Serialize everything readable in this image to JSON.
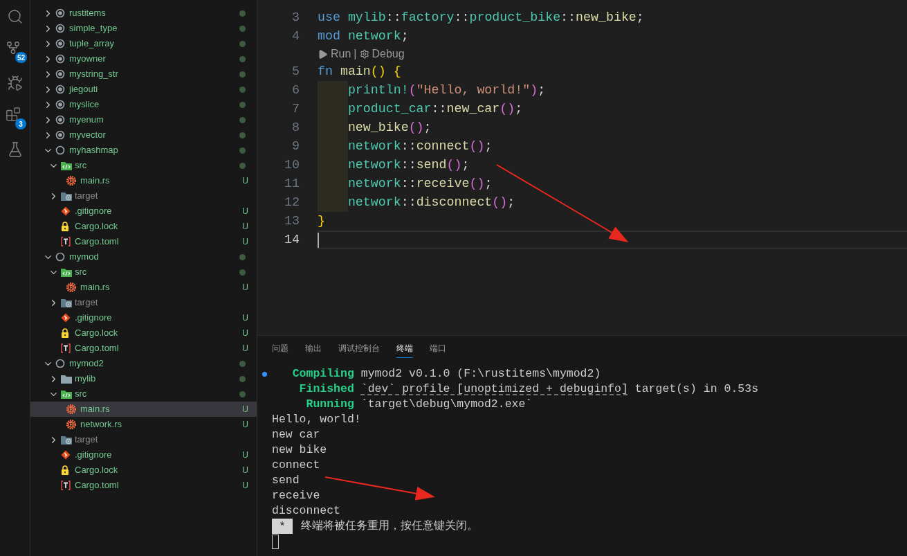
{
  "activity_bar": [
    {
      "kind": "search"
    },
    {
      "kind": "source-control",
      "badge": "52"
    },
    {
      "kind": "run-debug"
    },
    {
      "kind": "extensions",
      "badge": "3"
    },
    {
      "kind": "testing"
    }
  ],
  "explorer": {
    "items": [
      {
        "name": "rustitems",
        "kind": "project",
        "expanded": false,
        "modified": true,
        "selected": false
      },
      {
        "name": "simple_type",
        "kind": "project",
        "expanded": false,
        "modified": true,
        "selected": false
      },
      {
        "name": "tuple_array",
        "kind": "project",
        "expanded": false,
        "modified": true,
        "selected": false
      },
      {
        "name": "myowner",
        "kind": "project",
        "expanded": false,
        "modified": true,
        "selected": false
      },
      {
        "name": "mystring_str",
        "kind": "project",
        "expanded": false,
        "modified": true,
        "selected": false
      },
      {
        "name": "jiegouti",
        "kind": "project",
        "expanded": false,
        "modified": true,
        "selected": false
      },
      {
        "name": "myslice",
        "kind": "project",
        "expanded": false,
        "modified": true,
        "selected": false
      },
      {
        "name": "myenum",
        "kind": "project",
        "expanded": false,
        "modified": true,
        "selected": false
      },
      {
        "name": "myvector",
        "kind": "project",
        "expanded": false,
        "modified": true,
        "selected": false
      },
      {
        "name": "myhashmap",
        "kind": "project",
        "expanded": true,
        "modified": true,
        "selected": false,
        "children": [
          {
            "name": "src",
            "kind": "src-folder",
            "expanded": true,
            "modified": true,
            "selected": false,
            "children": [
              {
                "name": "main.rs",
                "kind": "rust",
                "status": "U",
                "modified": false,
                "selected": false
              }
            ]
          },
          {
            "name": "target",
            "kind": "target-folder",
            "expanded": false,
            "ignored": true,
            "modified": false,
            "selected": false
          },
          {
            "name": ".gitignore",
            "kind": "git",
            "status": "U",
            "modified": false,
            "selected": false
          },
          {
            "name": "Cargo.lock",
            "kind": "lock",
            "status": "U",
            "modified": false,
            "selected": false
          },
          {
            "name": "Cargo.toml",
            "kind": "toml",
            "status": "U",
            "modified": false,
            "selected": false
          }
        ]
      },
      {
        "name": "mymod",
        "kind": "project",
        "expanded": true,
        "modified": true,
        "selected": false,
        "children": [
          {
            "name": "src",
            "kind": "src-folder",
            "expanded": true,
            "modified": true,
            "selected": false,
            "children": [
              {
                "name": "main.rs",
                "kind": "rust",
                "status": "U",
                "modified": false,
                "selected": false
              }
            ]
          },
          {
            "name": "target",
            "kind": "target-folder",
            "expanded": false,
            "ignored": true,
            "modified": false,
            "selected": false
          },
          {
            "name": ".gitignore",
            "kind": "git",
            "status": "U",
            "modified": false,
            "selected": false
          },
          {
            "name": "Cargo.lock",
            "kind": "lock",
            "status": "U",
            "modified": false,
            "selected": false
          },
          {
            "name": "Cargo.toml",
            "kind": "toml",
            "status": "U",
            "modified": false,
            "selected": false
          }
        ]
      },
      {
        "name": "mymod2",
        "kind": "project",
        "expanded": true,
        "modified": true,
        "selected": false,
        "children": [
          {
            "name": "mylib",
            "kind": "folder",
            "expanded": false,
            "modified": true,
            "selected": false
          },
          {
            "name": "src",
            "kind": "src-folder",
            "expanded": true,
            "modified": true,
            "selected": false,
            "children": [
              {
                "name": "main.rs",
                "kind": "rust",
                "status": "U",
                "modified": false,
                "selected": true
              },
              {
                "name": "network.rs",
                "kind": "rust",
                "status": "U",
                "modified": false,
                "selected": false
              }
            ]
          },
          {
            "name": "target",
            "kind": "target-folder",
            "expanded": false,
            "ignored": true,
            "modified": false,
            "selected": false
          },
          {
            "name": ".gitignore",
            "kind": "git",
            "status": "U",
            "modified": false,
            "selected": false
          },
          {
            "name": "Cargo.lock",
            "kind": "lock",
            "status": "U",
            "modified": false,
            "selected": false
          },
          {
            "name": "Cargo.toml",
            "kind": "toml",
            "status": "U",
            "modified": false,
            "selected": false
          }
        ]
      }
    ]
  },
  "editor": {
    "lines": [
      {
        "kind": "code",
        "number": "3",
        "selected": false,
        "tokens": [
          {
            "kind": "keyword",
            "text": "use "
          },
          {
            "kind": "module",
            "text": "mylib"
          },
          {
            "kind": "punct",
            "text": "::"
          },
          {
            "kind": "module",
            "text": "factory"
          },
          {
            "kind": "punct",
            "text": "::"
          },
          {
            "kind": "module",
            "text": "product_bike"
          },
          {
            "kind": "punct",
            "text": "::"
          },
          {
            "kind": "function",
            "text": "new_bike"
          },
          {
            "kind": "punct",
            "text": ";"
          }
        ]
      },
      {
        "kind": "code",
        "number": "4",
        "selected": false,
        "tokens": [
          {
            "kind": "keyword",
            "text": "mod "
          },
          {
            "kind": "module",
            "text": "network"
          },
          {
            "kind": "punct",
            "text": ";"
          }
        ]
      },
      {
        "kind": "codelens",
        "run": "Run",
        "separator": "|",
        "debug": "Debug"
      },
      {
        "kind": "code",
        "number": "5",
        "selected": false,
        "tokens": [
          {
            "kind": "keyword",
            "text": "fn "
          },
          {
            "kind": "function",
            "text": "main"
          },
          {
            "kind": "bracket",
            "text": "() {"
          }
        ]
      },
      {
        "kind": "code",
        "number": "6",
        "selected": false,
        "indented": true,
        "tokens": [
          {
            "kind": "module",
            "text": "println!"
          },
          {
            "kind": "bracket2",
            "text": "("
          },
          {
            "kind": "string",
            "text": "\"Hello, world!\""
          },
          {
            "kind": "bracket2",
            "text": ")"
          },
          {
            "kind": "punct",
            "text": ";"
          }
        ]
      },
      {
        "kind": "code",
        "number": "7",
        "selected": false,
        "indented": true,
        "tokens": [
          {
            "kind": "module",
            "text": "product_car"
          },
          {
            "kind": "punct",
            "text": "::"
          },
          {
            "kind": "function",
            "text": "new_car"
          },
          {
            "kind": "bracket2",
            "text": "()"
          },
          {
            "kind": "punct",
            "text": ";"
          }
        ]
      },
      {
        "kind": "code",
        "number": "8",
        "selected": false,
        "indented": true,
        "tokens": [
          {
            "kind": "function",
            "text": "new_bike"
          },
          {
            "kind": "bracket2",
            "text": "()"
          },
          {
            "kind": "punct",
            "text": ";"
          }
        ]
      },
      {
        "kind": "code",
        "number": "9",
        "selected": false,
        "indented": true,
        "tokens": [
          {
            "kind": "module",
            "text": "network"
          },
          {
            "kind": "punct",
            "text": "::"
          },
          {
            "kind": "function",
            "text": "connect"
          },
          {
            "kind": "bracket2",
            "text": "()"
          },
          {
            "kind": "punct",
            "text": ";"
          }
        ]
      },
      {
        "kind": "code",
        "number": "10",
        "selected": false,
        "indented": true,
        "tokens": [
          {
            "kind": "module",
            "text": "network"
          },
          {
            "kind": "punct",
            "text": "::"
          },
          {
            "kind": "function",
            "text": "send"
          },
          {
            "kind": "bracket2",
            "text": "()"
          },
          {
            "kind": "punct",
            "text": ";"
          }
        ]
      },
      {
        "kind": "code",
        "number": "11",
        "selected": false,
        "indented": true,
        "tokens": [
          {
            "kind": "module",
            "text": "network"
          },
          {
            "kind": "punct",
            "text": "::"
          },
          {
            "kind": "function",
            "text": "receive"
          },
          {
            "kind": "bracket2",
            "text": "()"
          },
          {
            "kind": "punct",
            "text": ";"
          }
        ]
      },
      {
        "kind": "code",
        "number": "12",
        "selected": false,
        "indented": true,
        "tokens": [
          {
            "kind": "module",
            "text": "network"
          },
          {
            "kind": "punct",
            "text": "::"
          },
          {
            "kind": "function",
            "text": "disconnect"
          },
          {
            "kind": "bracket2",
            "text": "()"
          },
          {
            "kind": "punct",
            "text": ";"
          }
        ]
      },
      {
        "kind": "code",
        "number": "13",
        "selected": false,
        "tokens": [
          {
            "kind": "bracket",
            "text": "}"
          }
        ]
      },
      {
        "kind": "code",
        "number": "14",
        "selected": true
      }
    ]
  },
  "panel": {
    "tabs": [
      {
        "label": "问题",
        "selected": false
      },
      {
        "label": "输出",
        "selected": false
      },
      {
        "label": "调试控制台",
        "selected": false
      },
      {
        "label": "终端",
        "selected": true
      },
      {
        "label": "端口",
        "selected": false
      }
    ],
    "terminal": [
      {
        "kind": "output",
        "marker": true,
        "segments": [
          {
            "kind": "label",
            "text": "   Compiling"
          },
          {
            "kind": "text",
            "text": " mymod2 v0.1.0 (F:\\rustitems\\mymod2)"
          }
        ]
      },
      {
        "kind": "output",
        "marker": false,
        "segments": [
          {
            "kind": "label",
            "text": "    Finished "
          },
          {
            "kind": "link",
            "text": "`dev` profile [unoptimized + debuginfo]"
          },
          {
            "kind": "text",
            "text": " target(s) in 0.53s"
          }
        ]
      },
      {
        "kind": "output",
        "marker": false,
        "segments": [
          {
            "kind": "label",
            "text": "     Running"
          },
          {
            "kind": "text",
            "text": " `target\\debug\\mymod2.exe`"
          }
        ]
      },
      {
        "kind": "output",
        "marker": false,
        "segments": [
          {
            "kind": "text",
            "text": "Hello, world!"
          }
        ]
      },
      {
        "kind": "output",
        "marker": false,
        "segments": [
          {
            "kind": "text",
            "text": "new car"
          }
        ]
      },
      {
        "kind": "output",
        "marker": false,
        "segments": [
          {
            "kind": "text",
            "text": "new bike"
          }
        ]
      },
      {
        "kind": "output",
        "marker": false,
        "segments": [
          {
            "kind": "text",
            "text": "connect"
          }
        ]
      },
      {
        "kind": "output",
        "marker": false,
        "segments": [
          {
            "kind": "text",
            "text": "send"
          }
        ]
      },
      {
        "kind": "output",
        "marker": false,
        "segments": [
          {
            "kind": "text",
            "text": "receive"
          }
        ]
      },
      {
        "kind": "output",
        "marker": false,
        "segments": [
          {
            "kind": "text",
            "text": "disconnect"
          }
        ]
      },
      {
        "kind": "notice",
        "badge": "*",
        "text": "终端将被任务重用，按任意键关闭。"
      },
      {
        "kind": "cursor"
      }
    ]
  }
}
